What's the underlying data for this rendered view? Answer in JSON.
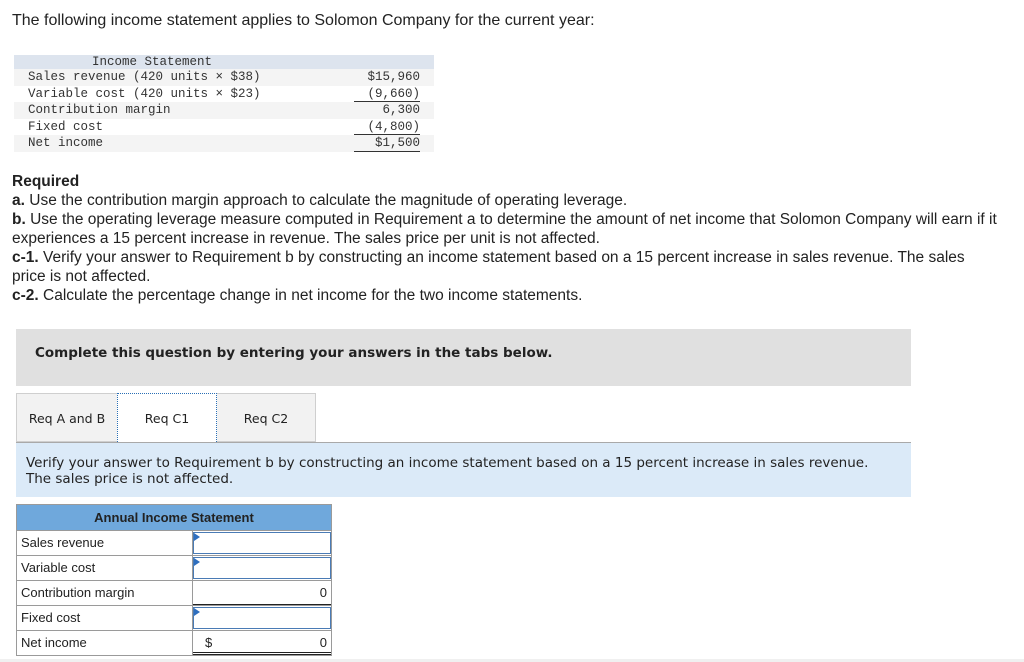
{
  "intro": "The following income statement applies to Solomon Company for the current year:",
  "income_statement": {
    "title": "Income Statement",
    "rows": [
      {
        "label": "Sales revenue (420 units × $38)",
        "value": "$15,960"
      },
      {
        "label": "Variable cost (420 units × $23)",
        "value": "(9,660)"
      },
      {
        "label": "Contribution margin",
        "value": "6,300"
      },
      {
        "label": "Fixed cost",
        "value": "(4,800)"
      },
      {
        "label": "Net income",
        "value": "$1,500"
      }
    ]
  },
  "required": {
    "title": "Required",
    "items": [
      {
        "key": "a.",
        "text": " Use the contribution margin approach to calculate the magnitude of operating leverage."
      },
      {
        "key": "b.",
        "text": " Use the operating leverage measure computed in Requirement a to determine the amount of net income that Solomon Company will earn if it experiences a 15 percent increase in revenue. The sales price per unit is not affected."
      },
      {
        "key": "c-1.",
        "text": " Verify your answer to Requirement b by constructing an income statement based on a 15 percent increase in sales revenue. The sales price is not affected."
      },
      {
        "key": "c-2.",
        "text": " Calculate the percentage change in net income for the two income statements."
      }
    ]
  },
  "instructions": "Complete this question by entering your answers in the tabs below.",
  "tabs": [
    {
      "label": "Req A and B",
      "active": false
    },
    {
      "label": "Req C1",
      "active": true
    },
    {
      "label": "Req C2",
      "active": false
    }
  ],
  "tab_description": "Verify your answer to Requirement b by constructing an income statement based on a 15 percent increase in sales revenue. The sales price is not affected.",
  "answer_table": {
    "title": "Annual Income Statement",
    "rows": [
      {
        "label": "Sales revenue",
        "input_value": "",
        "type": "input"
      },
      {
        "label": "Variable cost",
        "input_value": "",
        "type": "input"
      },
      {
        "label": "Contribution margin",
        "value": "0",
        "type": "computed"
      },
      {
        "label": "Fixed cost",
        "input_value": "",
        "type": "input"
      },
      {
        "label": "Net income",
        "currency": "$",
        "value": "0",
        "type": "computed"
      }
    ]
  },
  "colors": {
    "table_header": "#6fa8dc",
    "instruction_bg": "#e0e0e0",
    "tab_description_bg": "#dbeaf8",
    "input_border": "#4a7bb5"
  }
}
